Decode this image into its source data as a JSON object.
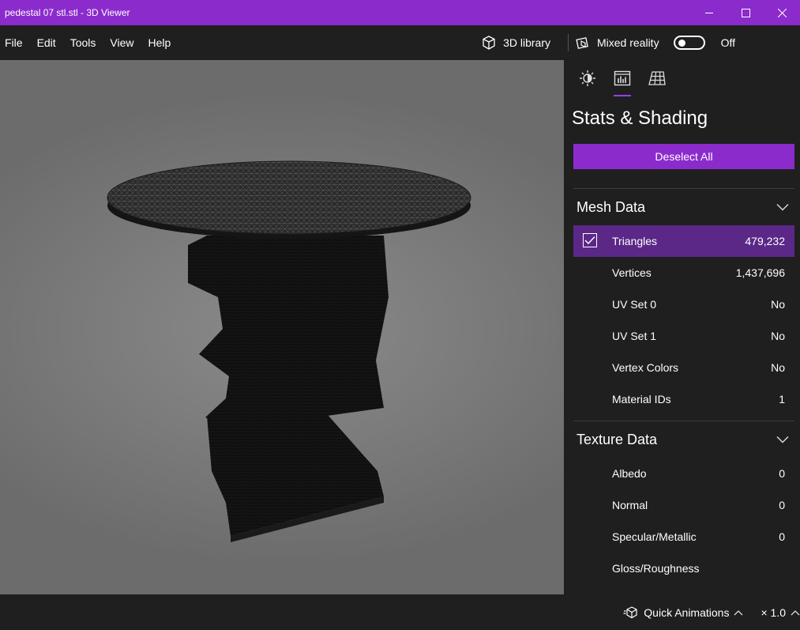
{
  "window": {
    "title": "pedestal 07 stl.stl - 3D Viewer"
  },
  "menu": {
    "items": [
      {
        "label": "File"
      },
      {
        "label": "Edit"
      },
      {
        "label": "Tools"
      },
      {
        "label": "View"
      },
      {
        "label": "Help"
      }
    ],
    "library_label": "3D library",
    "mixed_reality_label": "Mixed reality",
    "mixed_reality_state": "Off"
  },
  "panel": {
    "tabs": [
      {
        "icon": "lighting-icon"
      },
      {
        "icon": "stats-icon",
        "active": true
      },
      {
        "icon": "grid-icon"
      }
    ],
    "title": "Stats & Shading",
    "deselect_label": "Deselect All",
    "mesh_section": {
      "title": "Mesh Data",
      "rows": [
        {
          "label": "Triangles",
          "value": "479,232",
          "checked": true
        },
        {
          "label": "Vertices",
          "value": "1,437,696"
        },
        {
          "label": "UV Set 0",
          "value": "No"
        },
        {
          "label": "UV Set 1",
          "value": "No"
        },
        {
          "label": "Vertex Colors",
          "value": "No"
        },
        {
          "label": "Material IDs",
          "value": "1"
        }
      ]
    },
    "texture_section": {
      "title": "Texture Data",
      "rows": [
        {
          "label": "Albedo",
          "value": "0"
        },
        {
          "label": "Normal",
          "value": "0"
        },
        {
          "label": "Specular/Metallic",
          "value": "0"
        },
        {
          "label": "Gloss/Roughness",
          "value": ""
        }
      ]
    }
  },
  "status": {
    "quick_animations_label": "Quick Animations",
    "speed_label": "× 1.0"
  },
  "colors": {
    "accent": "#8b2bcc",
    "selected_row": "#5b2888",
    "background": "#1f1f1f"
  }
}
